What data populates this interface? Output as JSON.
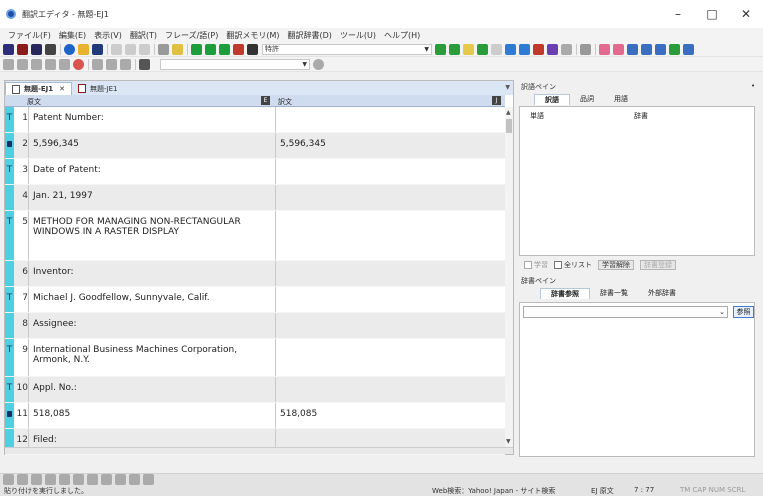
{
  "window": {
    "title": "翻訳エディタ - 無題-EJ1"
  },
  "menu": [
    "ファイル(F)",
    "編集(E)",
    "表示(V)",
    "翻訳(T)",
    "フレーズ/語(P)",
    "翻訳メモリ(M)",
    "翻訳辞書(D)",
    "ツール(U)",
    "ヘルプ(H)"
  ],
  "toolbar": {
    "field_combo": "特許"
  },
  "tabs": [
    "無題-EJ1",
    "無題-JE1"
  ],
  "columns": {
    "source": "原文",
    "target": "訳文"
  },
  "rows": [
    {
      "num": "1",
      "mark": "T",
      "src": "Patent Number:",
      "tgt": ""
    },
    {
      "num": "2",
      "mark": "lock",
      "src": "5,596,345",
      "tgt": "5,596,345"
    },
    {
      "num": "3",
      "mark": "T",
      "src": "Date of Patent:",
      "tgt": ""
    },
    {
      "num": "4",
      "mark": "",
      "src": "Jan. 21, 1997",
      "tgt": ""
    },
    {
      "num": "5",
      "mark": "T",
      "src": "METHOD FOR MANAGING NON-RECTANGULAR WINDOWS IN A RASTER DISPLAY",
      "tgt": ""
    },
    {
      "num": "6",
      "mark": "",
      "src": "Inventor:",
      "tgt": ""
    },
    {
      "num": "7",
      "mark": "T",
      "src": "Michael J. Goodfellow, Sunnyvale, Calif.",
      "tgt": ""
    },
    {
      "num": "8",
      "mark": "",
      "src": "Assignee:",
      "tgt": ""
    },
    {
      "num": "9",
      "mark": "T",
      "src": "International Business Machines Corporation, Armonk, N.Y.",
      "tgt": ""
    },
    {
      "num": "10",
      "mark": "T",
      "src": "Appl. No.:",
      "tgt": ""
    },
    {
      "num": "11",
      "mark": "lock",
      "src": "518,085",
      "tgt": "518,085"
    },
    {
      "num": "12",
      "mark": "",
      "src": "Filed:",
      "tgt": ""
    }
  ],
  "word_pane": {
    "title": "訳語ペイン",
    "tabs": [
      "訳語",
      "品詞",
      "用語"
    ],
    "col_word": "単語",
    "col_dict": "辞書",
    "opt_learn": "学習",
    "opt_all": "全リスト",
    "btn_unlearn": "学習解除",
    "btn_dict_register": "辞書登録"
  },
  "dict_pane": {
    "title": "辞書ペイン",
    "tabs": [
      "辞書参照",
      "辞書一覧",
      "外部辞書"
    ],
    "ref_button": "参照"
  },
  "status": {
    "message": "貼り付けを実行しました。",
    "web_search": "Web検索：Yahoo! Japan - サイト検索",
    "mode": "EJ 原文",
    "position": "7 : 77",
    "indicators": "TM CAP NUM SCRL"
  }
}
